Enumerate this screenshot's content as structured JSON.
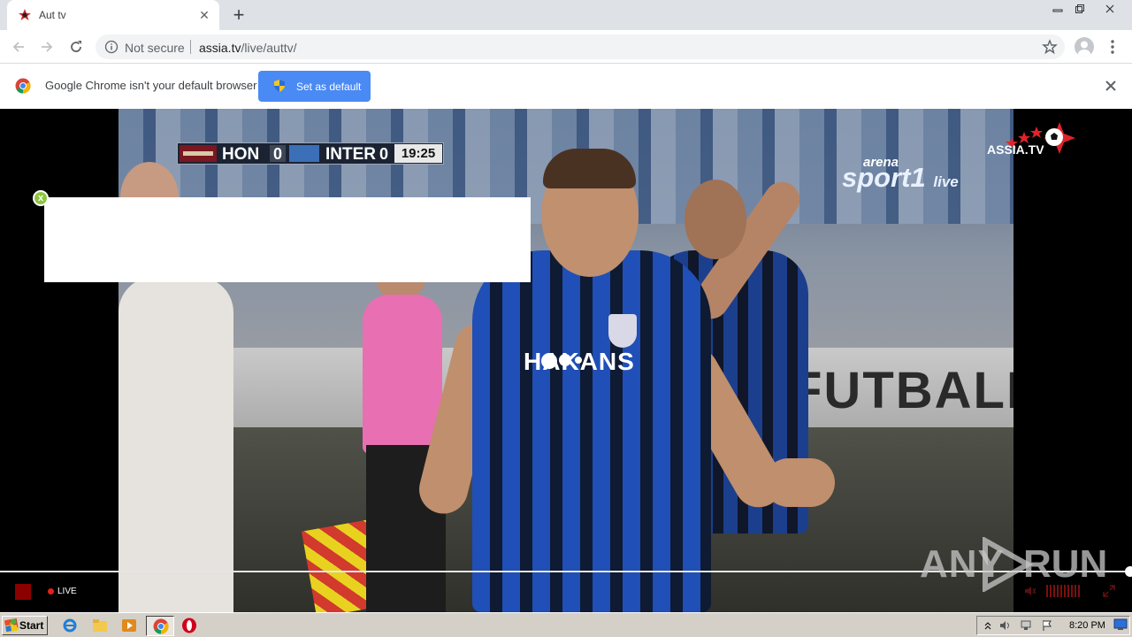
{
  "browser": {
    "tab_title": "Aut tv",
    "new_tab_symbol": "+",
    "security_label": "Not secure",
    "url_host": "assia.tv",
    "url_path": "/live/auttv/"
  },
  "infobar": {
    "message": "Google Chrome isn't your default browser",
    "button_label": "Set as default"
  },
  "video": {
    "scoreboard": {
      "team1": "HON",
      "score1": "0",
      "team2": "INTER",
      "score2": "0",
      "clock": "19:25"
    },
    "channel_arena": "arena",
    "channel_sport": "sport1",
    "channel_live": "live",
    "site_logo": "ASSIA.TV",
    "sponsor_text": "HAKANS",
    "board_text": "FUTBALL",
    "ad_close_symbol": "x"
  },
  "player": {
    "live_label": "LIVE"
  },
  "watermark": {
    "left": "ANY",
    "right": "RUN"
  },
  "taskbar": {
    "start_label": "Start",
    "clock": "8:20 PM"
  },
  "icons": [
    "back-arrow-icon",
    "forward-arrow-icon",
    "reload-icon",
    "info-icon",
    "star-icon",
    "profile-icon",
    "menu-icon",
    "chrome-logo-icon",
    "shield-icon",
    "close-icon",
    "ie-icon",
    "folder-icon",
    "media-player-icon",
    "chrome-icon",
    "opera-icon",
    "volume-icon",
    "fullscreen-icon",
    "stop-icon"
  ],
  "colors": {
    "accent_blue": "#4a8af4",
    "live_red": "#e62117",
    "tab_strip": "#dee1e6"
  }
}
